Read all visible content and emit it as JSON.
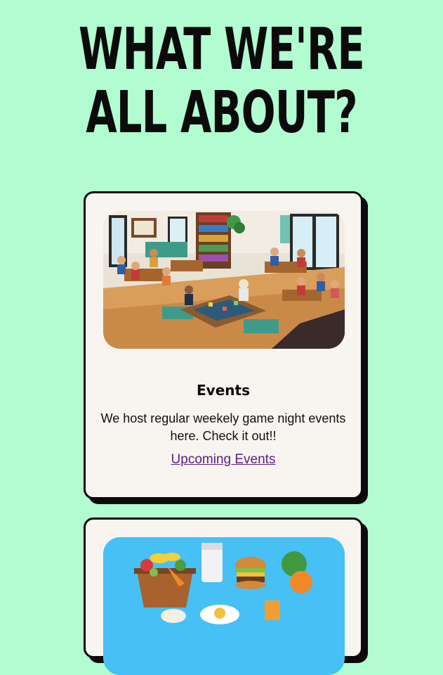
{
  "heading": {
    "line1": "What We're",
    "line2": "All About?"
  },
  "cards": [
    {
      "title": "Events",
      "text": "We host regular weekely game night events here. Check it out!!",
      "link_label": "Upcoming Events",
      "image_name": "game-night-illustration"
    },
    {
      "image_name": "food-illustration"
    }
  ],
  "colors": {
    "page_background": "#b2fcd1",
    "card_background": "#f8f4f0",
    "border": "#0b0b0b",
    "link": "#5b1d86",
    "food_image_background": "#46c0f5"
  }
}
